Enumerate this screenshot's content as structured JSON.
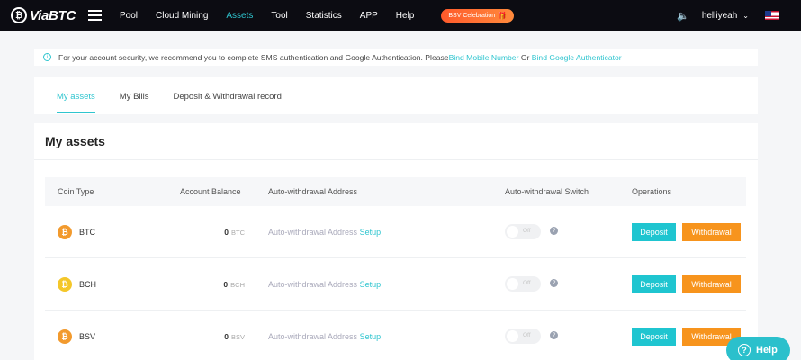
{
  "header": {
    "logo_text": "ViaBTC",
    "nav": [
      "Pool",
      "Cloud Mining",
      "Assets",
      "Tool",
      "Statistics",
      "APP",
      "Help"
    ],
    "active_nav": "Assets",
    "promo_label": "BSV Celebration",
    "username": "helliyeah",
    "accent_color": "#2fc5cf"
  },
  "notice": {
    "text": "For your account security, we recommend you to complete SMS authentication and Google Authentication. Please ",
    "link1": "Bind Mobile Number",
    "or_text": " Or ",
    "link2": "Bind Google Authenticator"
  },
  "tabs": [
    "My assets",
    "My Bills",
    "Deposit & Withdrawal record"
  ],
  "assets": {
    "title": "My assets",
    "columns": {
      "coin_type": "Coin Type",
      "balance": "Account Balance",
      "address": "Auto-withdrawal Address",
      "switch": "Auto-withdrawal Switch",
      "operations": "Operations"
    },
    "rows": [
      {
        "coin": "BTC",
        "balance": "0",
        "unit": "BTC",
        "address_text": "Auto-withdrawal Address",
        "setup": "Setup",
        "switch_text": "Off",
        "deposit": "Deposit",
        "withdrawal": "Withdrawal"
      },
      {
        "coin": "BCH",
        "balance": "0",
        "unit": "BCH",
        "address_text": "Auto-withdrawal Address",
        "setup": "Setup",
        "switch_text": "Off",
        "deposit": "Deposit",
        "withdrawal": "Withdrawal"
      },
      {
        "coin": "BSV",
        "balance": "0",
        "unit": "BSV",
        "address_text": "Auto-withdrawal Address",
        "setup": "Setup",
        "switch_text": "Off",
        "deposit": "Deposit",
        "withdrawal": "Withdrawal"
      }
    ]
  },
  "help_label": "Help"
}
